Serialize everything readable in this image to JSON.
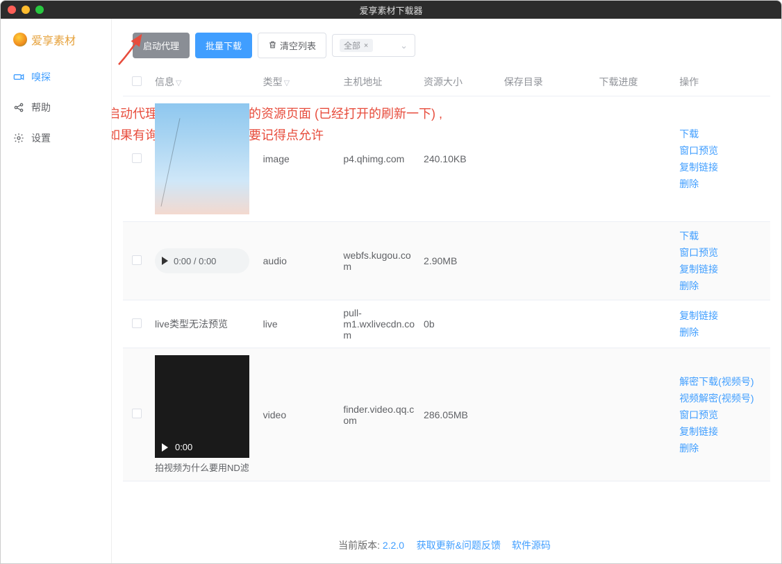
{
  "window": {
    "title": "爱享素材下载器"
  },
  "sidebar": {
    "brand": "爱享素材",
    "items": [
      {
        "label": "嗅探",
        "icon": "camera-icon",
        "active": true
      },
      {
        "label": "帮助",
        "icon": "share-icon",
        "active": false
      },
      {
        "label": "设置",
        "icon": "gear-icon",
        "active": false
      }
    ]
  },
  "toolbar": {
    "start_proxy": "启动代理",
    "batch_download": "批量下载",
    "clear_list": "清空列表",
    "filter_selected": "全部"
  },
  "annotation": {
    "line1": "先点击启动代理 再打开需要抓取的资源页面 (已经打开的刷新一下) ,",
    "line2": "安装是如果有询问网络相关 一定要记得点允许"
  },
  "table": {
    "headers": {
      "info": "信息",
      "type": "类型",
      "host": "主机地址",
      "size": "资源大小",
      "savepath": "保存目录",
      "progress": "下载进度",
      "action": "操作"
    },
    "action_labels": {
      "download": "下载",
      "preview": "窗口预览",
      "copy": "复制链接",
      "delete": "删除",
      "decrypt_download": "解密下载(视频号)",
      "decrypt_video": "视频解密(视频号)"
    },
    "rows": [
      {
        "info_kind": "image",
        "type": "image",
        "host": "p4.qhimg.com",
        "size": "240.10KB",
        "actions": [
          "download",
          "preview",
          "copy",
          "delete"
        ]
      },
      {
        "info_kind": "audio",
        "audio_time": "0:00 / 0:00",
        "type": "audio",
        "host": "webfs.kugou.com",
        "size": "2.90MB",
        "actions": [
          "download",
          "preview",
          "copy",
          "delete"
        ]
      },
      {
        "info_kind": "text",
        "info_text": "live类型无法预览",
        "type": "live",
        "host": "pull-m1.wxlivecdn.com",
        "size": "0b",
        "actions": [
          "copy",
          "delete"
        ]
      },
      {
        "info_kind": "video",
        "video_time": "0:00",
        "video_caption": "拍视频为什么要用ND滤",
        "type": "video",
        "host": "finder.video.qq.com",
        "size": "286.05MB",
        "actions": [
          "decrypt_download",
          "decrypt_video",
          "preview",
          "copy",
          "delete"
        ]
      }
    ]
  },
  "footer": {
    "version_label": "当前版本:",
    "version_number": "2.2.0",
    "update_feedback": "获取更新&问题反馈",
    "source_code": "软件源码"
  }
}
